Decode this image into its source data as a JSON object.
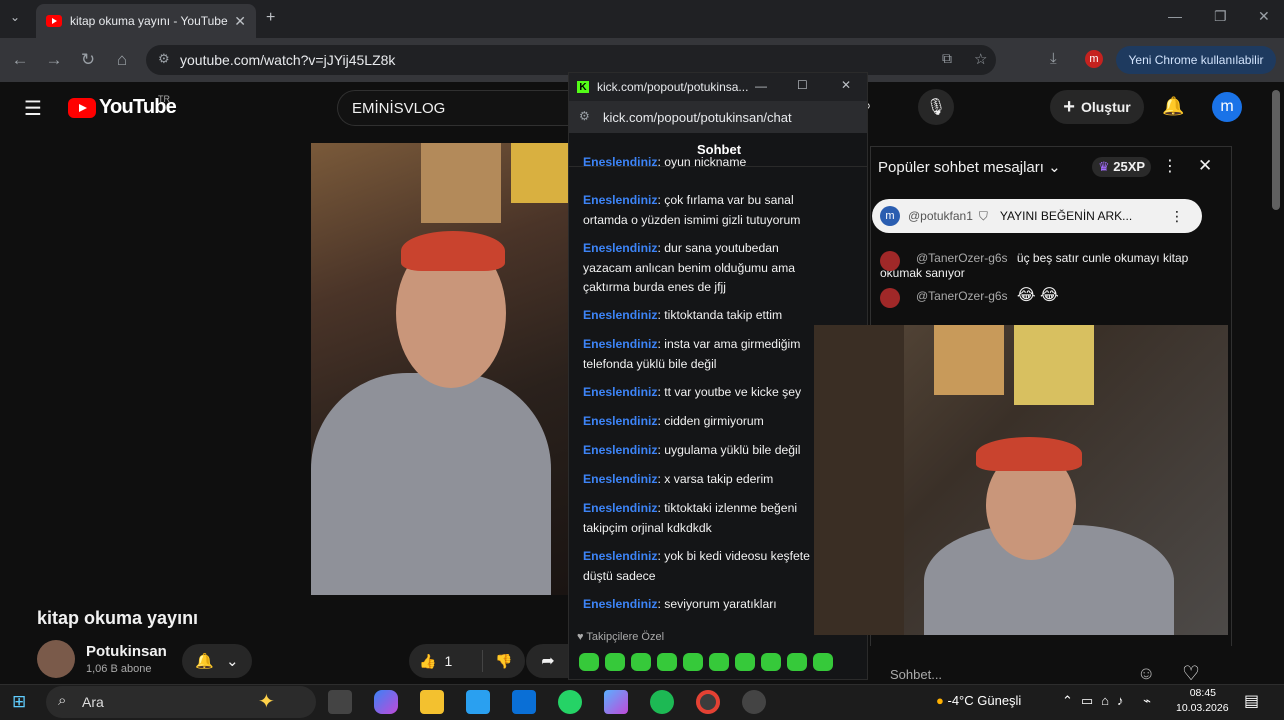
{
  "browser": {
    "tab_title": "kitap okuma yayını - YouTube",
    "url": "youtube.com/watch?v=jJYij45LZ8k",
    "promo": "Yeni Chrome kullanılabilir",
    "profile_initial": "m"
  },
  "youtube": {
    "logo_text": "YouTube",
    "region": "TR",
    "search_value": "EMİNİSVLOG",
    "create_label": "Oluştur",
    "avatar_initial": "m",
    "video_title": "kitap okuma yayını",
    "channel_name": "Potukinsan",
    "subscribers": "1,06 B abone",
    "like_count": "1"
  },
  "kick": {
    "window_title": "kick.com/popout/potukinsa...",
    "url": "kick.com/popout/potukinsan/chat",
    "tab_label": "Sohbet",
    "partial_top": {
      "user": "Eneslendiniz",
      "text": ": oyun nickname"
    },
    "messages": [
      {
        "user": "Eneslendiniz",
        "text": ": çok fırlama var bu sanal ortamda o yüzden ismimi gizli tutuyorum"
      },
      {
        "user": "Eneslendiniz",
        "text": ": dur sana youtubedan yazacam anlıcan benim olduğumu ama çaktırma burda enes de jfjj"
      },
      {
        "user": "Eneslendiniz",
        "text": ": tiktoktanda takip ettim"
      },
      {
        "user": "Eneslendiniz",
        "text": ": insta var ama girmediğim telefonda yüklü bile değil"
      },
      {
        "user": "Eneslendiniz",
        "text": ": tt var youtbe ve kicke şey"
      },
      {
        "user": "Eneslendiniz",
        "text": ": cidden girmiyorum"
      },
      {
        "user": "Eneslendiniz",
        "text": ": uygulama yüklü bile değil"
      },
      {
        "user": "Eneslendiniz",
        "text": ": x varsa takip ederim"
      },
      {
        "user": "Eneslendiniz",
        "text": ": tiktoktaki izlenme beğeni takipçim orjinal kdkdkdk"
      },
      {
        "user": "Eneslendiniz",
        "text": ": yok bi kedi videosu keşfete düştü sadece"
      },
      {
        "user": "Eneslendiniz",
        "text": ": seviyorum yaratıkları"
      }
    ],
    "followers_only": "Takipçilere Özel"
  },
  "live_chat": {
    "header": "Popüler sohbet mesajları",
    "xp": "25XP",
    "pinned_user": "@potukfan1",
    "pinned_text": "YAYINI BEĞENİN ARK...",
    "messages": [
      {
        "user": "@TanerOzer-g6s",
        "text": "üç beş satır cunle okumayı kitap okumak sanıyor"
      },
      {
        "user": "@TanerOzer-g6s",
        "text": "😂 😂"
      }
    ],
    "input_placeholder": "Sohbet..."
  },
  "taskbar": {
    "search": "Ara",
    "weather": "-4°C  Güneşli",
    "time": "08:45",
    "date": "10.03.2026"
  }
}
